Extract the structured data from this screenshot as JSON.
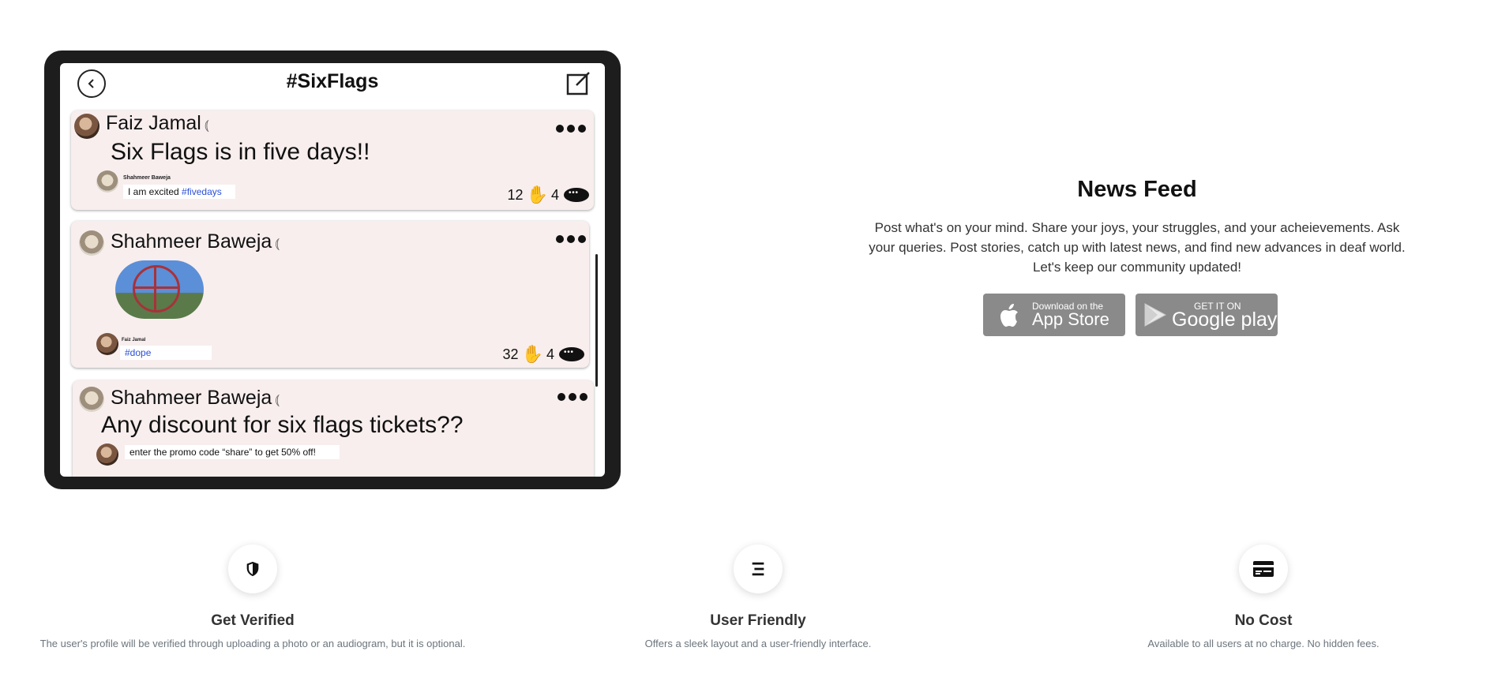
{
  "app": {
    "title": "#SixFlags"
  },
  "posts": [
    {
      "author": "Faiz Jamal",
      "text": "Six Flags is in five days!!",
      "comment": {
        "author": "Shahmeer Baweja",
        "text": "I am excited",
        "tag": "#fivedays"
      },
      "likes": "12",
      "comments": "4"
    },
    {
      "author": "Shahmeer Baweja",
      "comment": {
        "author": "Faiz Jamal",
        "tag": "#dope"
      },
      "likes": "32",
      "comments": "4"
    },
    {
      "author": "Shahmeer Baweja",
      "text": "Any discount for six flags tickets??",
      "comment": {
        "text": "enter the promo code “share” to get 50% off!"
      }
    }
  ],
  "news_feed": {
    "title": "News Feed",
    "description": "Post what's on your mind. Share your joys, your struggles, and your acheievements. Ask your queries. Post stories, catch up with latest news, and find new advances in deaf world. Let's keep our community updated!",
    "appstore_small": "Download on the",
    "appstore_big": "App Store",
    "google_small": "GET IT ON",
    "google_big": "Google play"
  },
  "features": [
    {
      "icon": "shield-icon",
      "title": "Get Verified",
      "desc": "The user's profile will be verified through uploading a photo or an audiogram, but it is optional."
    },
    {
      "icon": "menu-lines-icon",
      "title": "User Friendly",
      "desc": "Offers a sleek layout and a user-friendly interface."
    },
    {
      "icon": "card-icon",
      "title": "No Cost",
      "desc": "Available to all users at no charge. No hidden fees."
    }
  ]
}
